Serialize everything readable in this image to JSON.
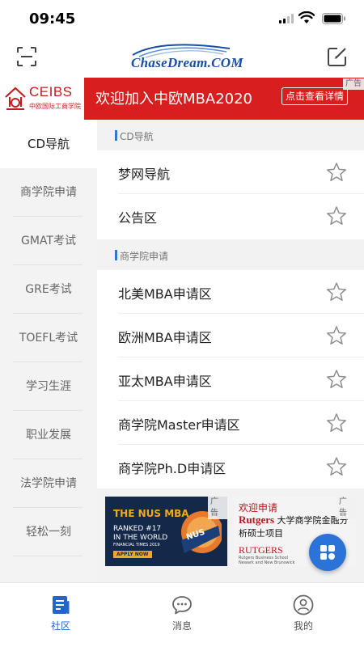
{
  "status_bar": {
    "time": "09:45"
  },
  "header": {
    "logo_text": "ChaseDream.COM",
    "scan_icon": "scan-icon",
    "edit_icon": "edit-icon"
  },
  "banner": {
    "brand": "CEIBS",
    "brand_sub": "中欧国际工商学院",
    "title": "欢迎加入中欧MBA2020",
    "cta": "点击查看详情",
    "ad_tag": "广告"
  },
  "sidebar": {
    "items": [
      {
        "label": "CD导航",
        "active": true
      },
      {
        "label": "商学院申请"
      },
      {
        "label": "GMAT考试"
      },
      {
        "label": "GRE考试"
      },
      {
        "label": "TOEFL考试"
      },
      {
        "label": "学习生涯"
      },
      {
        "label": "职业发展"
      },
      {
        "label": "法学院申请"
      },
      {
        "label": "轻松一刻"
      }
    ]
  },
  "sections": [
    {
      "title": "CD导航",
      "rows": [
        "梦网导航",
        "公告区"
      ]
    },
    {
      "title": "商学院申请",
      "rows": [
        "北美MBA申请区",
        "欧洲MBA申请区",
        "亚太MBA申请区",
        "商学院Master申请区",
        "商学院Ph.D申请区"
      ]
    }
  ],
  "ads": {
    "tag": "广告",
    "nus": {
      "title": "THE NUS MBA",
      "line1": "RANKED #17",
      "line2": "IN THE WORLD",
      "line3": "FINANCIAL TIMES 2019",
      "cta": "APPLY NOW",
      "crest": "NUS"
    },
    "rutgers": {
      "headline": "欢迎申请",
      "brand": "Rutgers",
      "desc": "大学商学院金融分析硕士项目",
      "logo": "RUTGERS",
      "sub1": "Rutgers Business School",
      "sub2": "Newark and New Brunswick"
    }
  },
  "tabbar": {
    "tabs": [
      {
        "label": "社区",
        "icon": "community-icon",
        "active": true
      },
      {
        "label": "消息",
        "icon": "message-icon"
      },
      {
        "label": "我的",
        "icon": "profile-icon"
      }
    ]
  },
  "colors": {
    "accent": "#2067c7",
    "banner_red": "#d81e1e",
    "fab_blue": "#2b73d6"
  }
}
